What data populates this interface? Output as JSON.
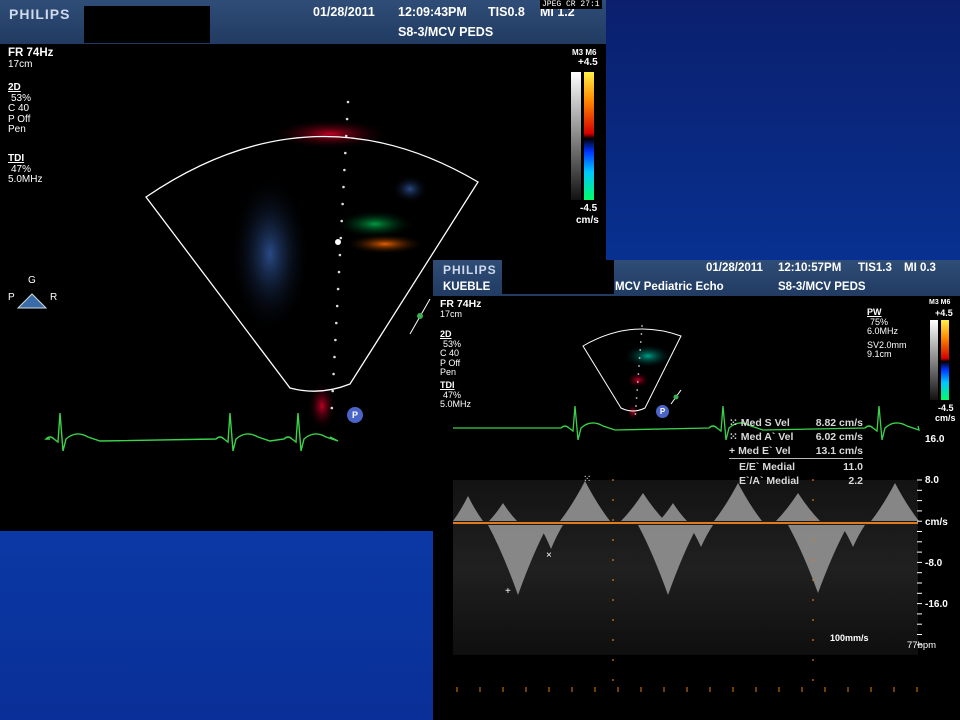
{
  "window1": {
    "brand": "PHILIPS",
    "jpeg_tag": "JPEG CR 27:1",
    "date": "01/28/2011",
    "time": "12:09:43PM",
    "tis": "TIS0.8",
    "mi": "MI 1.2",
    "probe_preset": "S8-3/MCV PEDS",
    "fr": "FR 74Hz",
    "depth": "17cm",
    "mode_2d": {
      "title": "2D",
      "lines": [
        "53%",
        "C 40",
        "P Off",
        "Pen"
      ]
    },
    "mode_tdi": {
      "title": "TDI",
      "lines": [
        "47%",
        "5.0MHz"
      ]
    },
    "colorbar": {
      "label": "M3 M6",
      "top": "+4.5",
      "bottom": "-4.5",
      "unit": "cm/s"
    },
    "orientation": {
      "top": "G",
      "left": "P",
      "right": "R"
    },
    "p_marker": "P"
  },
  "window2": {
    "brand": "PHILIPS",
    "date": "01/28/2011",
    "time": "12:10:57PM",
    "tis": "TIS1.3",
    "mi": "MI 0.3",
    "patient": "KUEBLE",
    "study": "MCV Pediatric Echo",
    "probe_preset": "S8-3/MCV PEDS",
    "fr": "FR 74Hz",
    "depth": "17cm",
    "mode_2d": {
      "title": "2D",
      "lines": [
        "53%",
        "C 40",
        "P Off",
        "Pen"
      ]
    },
    "mode_tdi": {
      "title": "TDI",
      "lines": [
        "47%",
        "5.0MHz"
      ]
    },
    "pw": {
      "title": "PW",
      "lines": [
        "75%",
        "6.0MHz"
      ],
      "sv": "SV2.0mm",
      "sv_depth": "9.1cm"
    },
    "colorbar": {
      "label": "M3 M6",
      "top": "+4.5",
      "bottom": "-4.5",
      "unit": "cm/s"
    },
    "measurements": [
      {
        "marker": "⁙",
        "label": "Med S Vel",
        "value": "8.82 cm/s"
      },
      {
        "marker": "⁙",
        "label": "Med A` Vel",
        "value": "6.02 cm/s"
      },
      {
        "marker": "+",
        "label": "Med E` Vel",
        "value": "13.1 cm/s"
      },
      {
        "marker": "",
        "label": "E/E` Medial",
        "value": "11.0"
      },
      {
        "marker": "",
        "label": "E`/A` Medial",
        "value": "2.2"
      }
    ],
    "scale": [
      "16.0",
      "8.0",
      "cm/s",
      "-8.0",
      "-16.0"
    ],
    "sweep": "100mm/s",
    "heart_rate": "77bpm",
    "p_marker": "P"
  }
}
